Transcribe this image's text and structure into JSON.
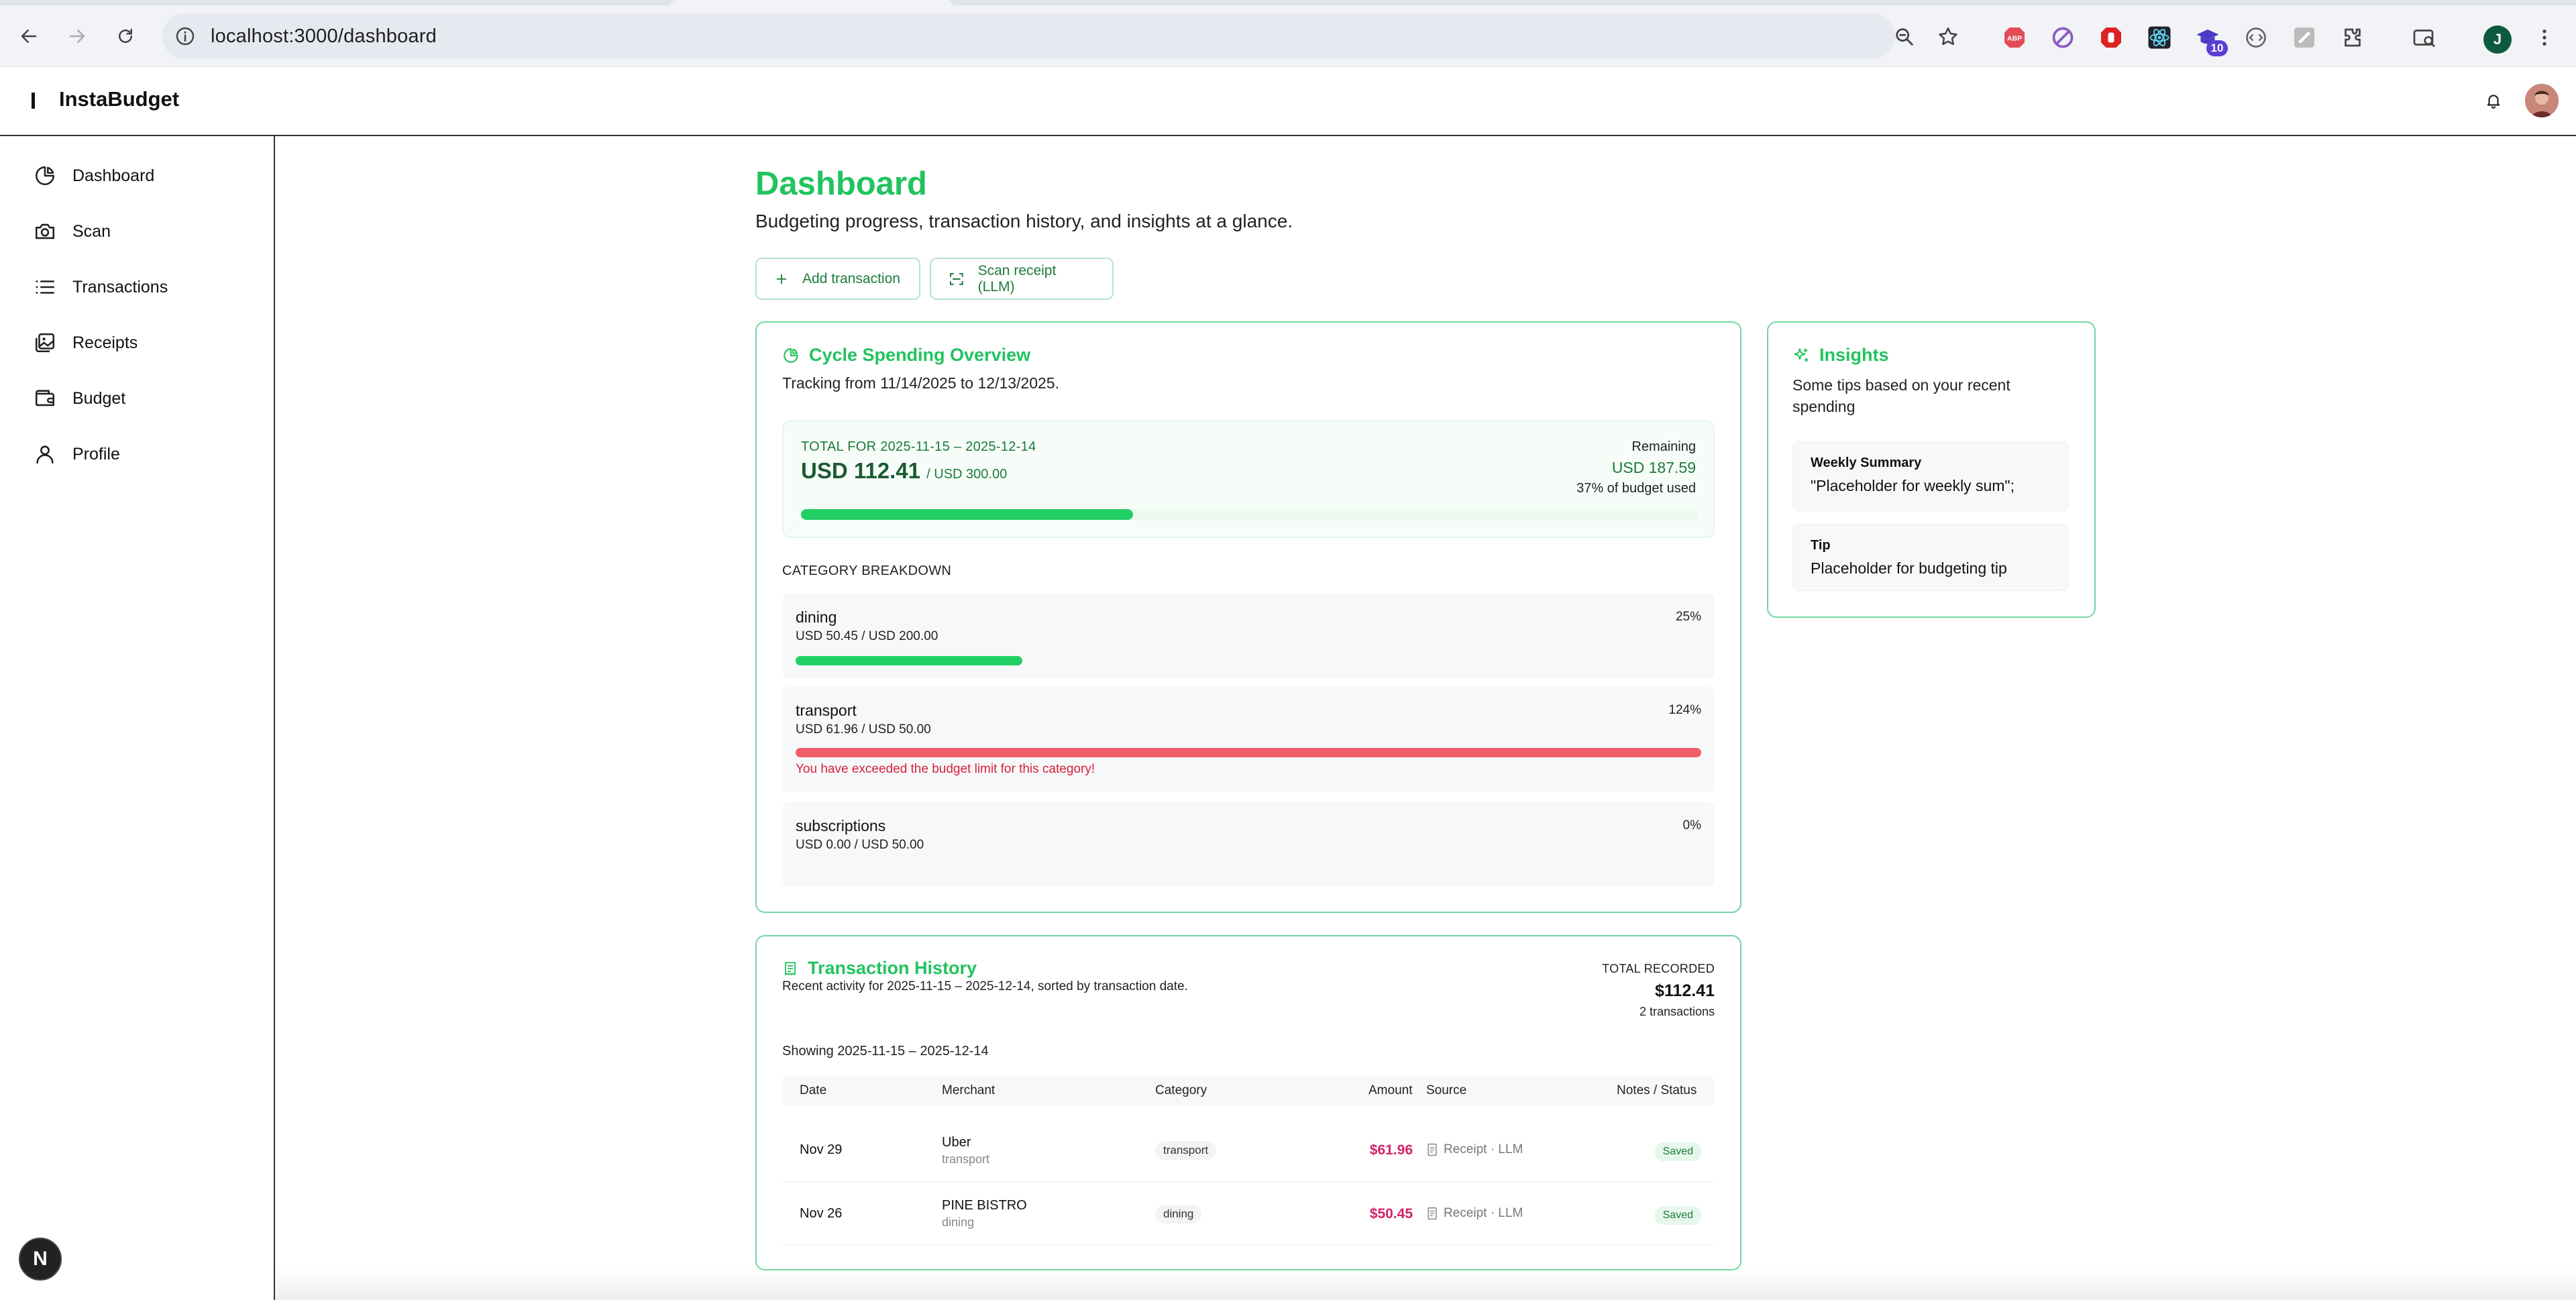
{
  "browser": {
    "url": "localhost:3000/dashboard",
    "extension_badge": "10",
    "profile_initial": "J"
  },
  "app": {
    "brand": "InstaBudget"
  },
  "sidebar": {
    "items": [
      {
        "label": "Dashboard",
        "icon": "pie-chart-icon"
      },
      {
        "label": "Scan",
        "icon": "camera-icon"
      },
      {
        "label": "Transactions",
        "icon": "list-icon"
      },
      {
        "label": "Receipts",
        "icon": "images-icon"
      },
      {
        "label": "Budget",
        "icon": "wallet-icon"
      },
      {
        "label": "Profile",
        "icon": "user-icon"
      }
    ],
    "dev_badge": "N"
  },
  "page": {
    "title": "Dashboard",
    "subtitle": "Budgeting progress, transaction history, and insights at a glance.",
    "add_button": "Add transaction",
    "scan_button": "Scan receipt (LLM)"
  },
  "overview": {
    "title": "Cycle Spending Overview",
    "tracking": "Tracking from 11/14/2025 to 12/13/2025.",
    "total_label": "TOTAL FOR 2025-11-15 – 2025-12-14",
    "total_amount": "USD 112.41",
    "total_of": "/ USD 300.00",
    "remaining_label": "Remaining",
    "remaining_amount": "USD 187.59",
    "used_text": "37% of budget used",
    "used_fraction": 0.37,
    "breakdown_label": "CATEGORY BREAKDOWN",
    "categories": [
      {
        "name": "dining",
        "values": "USD 50.45 / USD 200.00",
        "pct": "25%",
        "fraction": 0.25,
        "status": "ok"
      },
      {
        "name": "transport",
        "values": "USD 61.96 / USD 50.00",
        "pct": "124%",
        "fraction": 1.0,
        "status": "over",
        "warning": "You have exceeded the budget limit for this category!"
      },
      {
        "name": "subscriptions",
        "values": "USD 0.00 / USD 50.00",
        "pct": "0%",
        "fraction": 0,
        "status": "ok"
      }
    ]
  },
  "insights": {
    "title": "Insights",
    "subtitle": "Some tips based on your recent spending",
    "weekly_heading": "Weekly Summary",
    "weekly_body": "\"Placeholder for weekly sum\";",
    "tip_heading": "Tip",
    "tip_body": "Placeholder for budgeting tip"
  },
  "history": {
    "title": "Transaction History",
    "subtitle": "Recent activity for 2025-11-15 – 2025-12-14, sorted by transaction date.",
    "total_label": "TOTAL RECORDED",
    "total_amount": "$112.41",
    "count": "2 transactions",
    "showing": "Showing 2025-11-15 – 2025-12-14",
    "columns": [
      "Date",
      "Merchant",
      "Category",
      "Amount",
      "Source",
      "Notes / Status"
    ],
    "rows": [
      {
        "date": "Nov 29",
        "merchant": "Uber",
        "merchant_sub": "transport",
        "category": "transport",
        "amount": "$61.96",
        "source": "Receipt · LLM",
        "status": "Saved"
      },
      {
        "date": "Nov 26",
        "merchant": "PINE BISTRO",
        "merchant_sub": "dining",
        "category": "dining",
        "amount": "$50.45",
        "source": "Receipt · LLM",
        "status": "Saved"
      }
    ]
  },
  "colors": {
    "accent": "#22c35e",
    "bar_green": "#22d065",
    "bar_red": "#ef5f6a",
    "card_border": "#74d6a2",
    "amount_red": "#d4226a"
  }
}
